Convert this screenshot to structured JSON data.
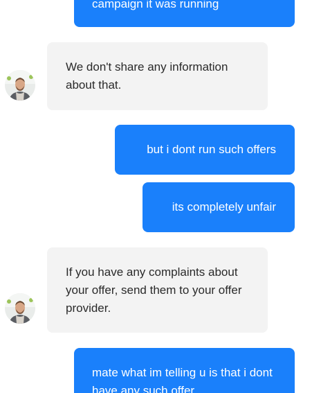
{
  "messages": [
    {
      "from": "user",
      "text": "campaign it was running"
    },
    {
      "from": "agent",
      "text": "We don't share any information about that."
    },
    {
      "from": "user",
      "text": "but i dont run such offers"
    },
    {
      "from": "user",
      "text": "its completely unfair"
    },
    {
      "from": "agent",
      "text": "If you have any complaints about your offer, send them to your offer provider."
    },
    {
      "from": "user",
      "text": "mate what im telling u is that i dont have any such offer"
    }
  ],
  "colors": {
    "user_bubble": "#1a80fb",
    "agent_bubble": "#f3f3f3",
    "agent_text": "#2a2a2a",
    "user_text": "#ffffff"
  },
  "agent": {
    "avatar_icon": "agent-avatar"
  }
}
